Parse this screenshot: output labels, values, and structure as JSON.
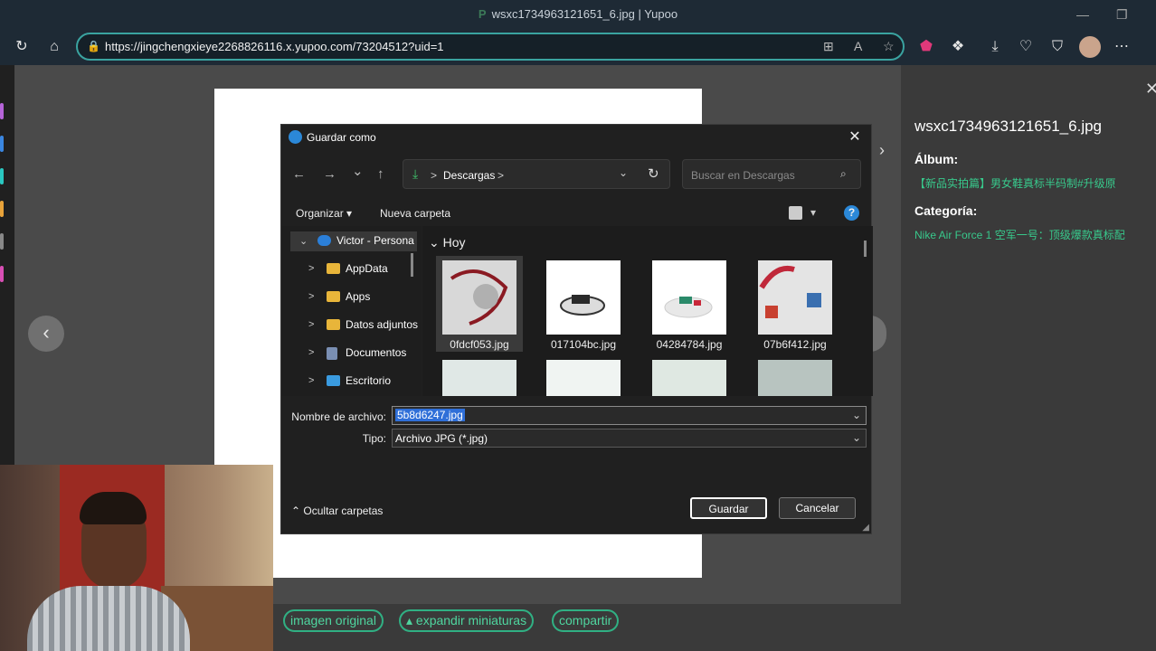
{
  "window": {
    "title": "wsxc1734963121651_6.jpg | Yupoo",
    "minimize": "—",
    "maximize": "❐"
  },
  "browser": {
    "url": "https://jingchengxieye2268826116.x.yupoo.com/73204512?uid=1"
  },
  "viewer": {
    "prev": "‹",
    "next": "›"
  },
  "info": {
    "filename": "wsxc1734963121651_6.jpg",
    "album_label": "Álbum:",
    "album_value": "【新品实拍篇】男女鞋真标半码制#升级原",
    "category_label": "Categoría:",
    "category_value": "Nike Air Force 1 空军一号：顶级爆款真标配"
  },
  "actions": {
    "original": "imagen original",
    "expand": "▴ expandir miniaturas",
    "share": "compartir"
  },
  "dialog": {
    "title": "Guardar como",
    "close": "✕",
    "back": "←",
    "forward": "→",
    "recent": "⌄",
    "up": "↑",
    "breadcrumb_sep": ">",
    "breadcrumb": "Descargas",
    "refresh": "↻",
    "search_placeholder": "Buscar en Descargas",
    "organize": "Organizar ▾",
    "new_folder": "Nueva carpeta",
    "help": "?",
    "tree": [
      {
        "label": "Victor - Persona",
        "chevron": "⌄",
        "color": "#2b7fd8"
      },
      {
        "label": "AppData",
        "chevron": ">",
        "color": "#e8b53a"
      },
      {
        "label": "Apps",
        "chevron": ">",
        "color": "#e8b53a"
      },
      {
        "label": "Datos adjuntos",
        "chevron": ">",
        "color": "#e8b53a"
      },
      {
        "label": "Documentos",
        "chevron": ">",
        "color": "#7a8fb3"
      },
      {
        "label": "Escritorio",
        "chevron": ">",
        "color": "#3a9be0"
      }
    ],
    "group": "⌄ Hoy",
    "files": [
      "0fdcf053.jpg",
      "017104bc.jpg",
      "04284784.jpg",
      "07b6f412.jpg"
    ],
    "filename_label": "Nombre de archivo:",
    "filename_value": "5b8d6247.jpg",
    "type_label": "Tipo:",
    "type_value": "Archivo JPG (*.jpg)",
    "hide_folders": "⌃ Ocultar carpetas",
    "save": "Guardar",
    "cancel": "Cancelar"
  }
}
